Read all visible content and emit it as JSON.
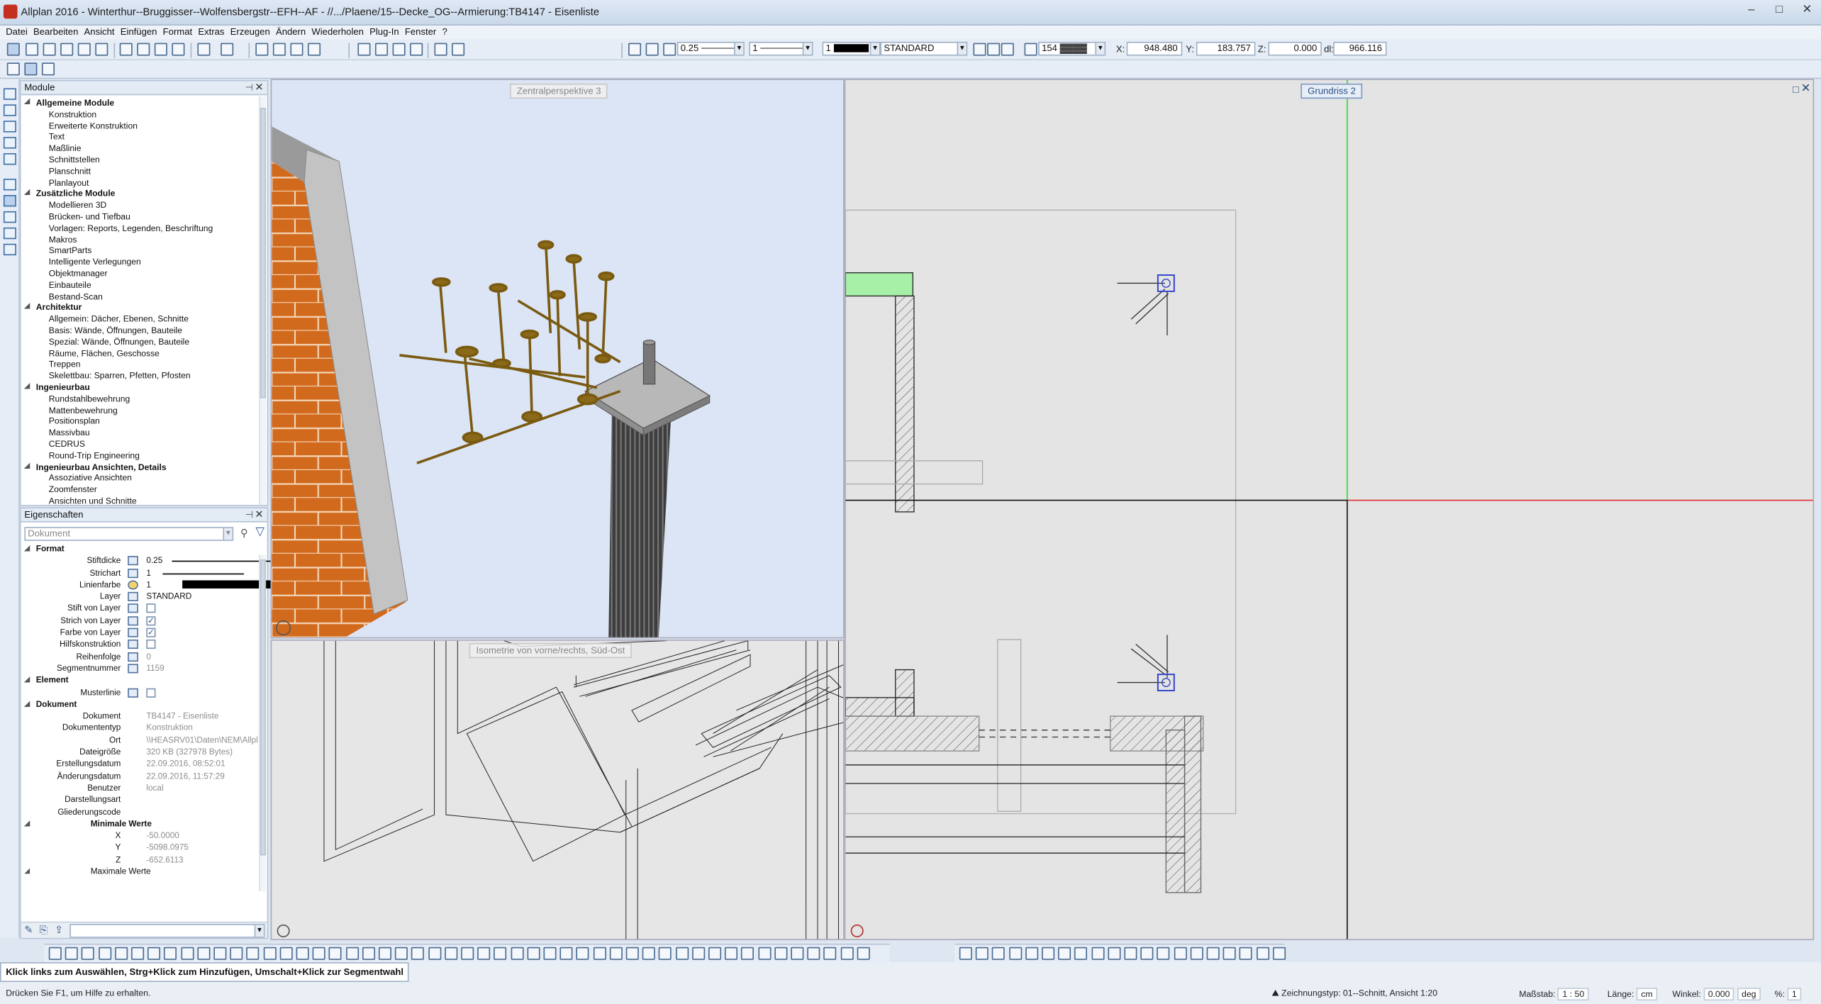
{
  "window": {
    "title": "Allplan 2016 - Winterthur--Bruggisser--Wolfensbergstr--EFH--AF - //.../Plaene/15--Decke_OG--Armierung:TB4147 - Eisenliste",
    "controls": [
      "–",
      "□",
      "✕"
    ]
  },
  "menu": [
    "Datei",
    "Bearbeiten",
    "Ansicht",
    "Einfügen",
    "Format",
    "Extras",
    "Erzeugen",
    "Ändern",
    "Wiederholen",
    "Plug-In",
    "Fenster",
    "?"
  ],
  "format_toolbar": {
    "pen": "0.25",
    "line": "1",
    "color": "1",
    "layer": "STANDARD",
    "pattern": "154"
  },
  "coords": {
    "x_label": "X:",
    "x": "948.480",
    "y_label": "Y:",
    "y": "183.757",
    "z_label": "Z:",
    "z": "0.000",
    "d_label": "dl:",
    "d": "966.116"
  },
  "modules_panel": {
    "title": "Module",
    "groups": [
      {
        "name": "Allgemeine Module",
        "items": [
          "Konstruktion",
          "Erweiterte Konstruktion",
          "Text",
          "Maßlinie",
          "Schnittstellen",
          "Planschnitt",
          "Planlayout"
        ]
      },
      {
        "name": "Zusätzliche Module",
        "items": [
          "Modellieren 3D",
          "Brücken- und Tiefbau",
          "Vorlagen: Reports, Legenden, Beschriftung",
          "Makros",
          "SmartParts",
          "Intelligente Verlegungen",
          "Objektmanager",
          "Einbauteile",
          "Bestand-Scan"
        ]
      },
      {
        "name": "Architektur",
        "items": [
          "Allgemein: Dächer, Ebenen, Schnitte",
          "Basis: Wände, Öffnungen, Bauteile",
          "Spezial: Wände, Öffnungen, Bauteile",
          "Räume, Flächen, Geschosse",
          "Treppen",
          "Skelettbau: Sparren, Pfetten, Pfosten"
        ]
      },
      {
        "name": "Ingenieurbau",
        "items": [
          "Rundstahlbewehrung",
          "Mattenbewehrung",
          "Positionsplan",
          "Massivbau",
          "CEDRUS",
          "Round-Trip Engineering"
        ]
      },
      {
        "name": "Ingenieurbau Ansichten, Details",
        "items": [
          "Assoziative Ansichten",
          "Zoomfenster",
          "Ansichten und Schnitte"
        ]
      }
    ]
  },
  "properties_panel": {
    "title": "Eigenschaften",
    "search_placeholder": "Dokument",
    "format_title": "Format",
    "format": {
      "stiftdicke_label": "Stiftdicke",
      "stiftdicke": "0.25",
      "strichart_label": "Strichart",
      "strichart": "1",
      "linienfarbe_label": "Linienfarbe",
      "linienfarbe": "1",
      "layer_label": "Layer",
      "layer": "STANDARD",
      "stift_von_layer_label": "Stift von Layer",
      "stift_von_layer": false,
      "strich_von_layer_label": "Strich von Layer",
      "strich_von_layer": true,
      "farbe_von_layer_label": "Farbe von Layer",
      "farbe_von_layer": true,
      "hilfskonstruktion_label": "Hilfskonstruktion",
      "hilfskonstruktion": false,
      "reihenfolge_label": "Reihenfolge",
      "reihenfolge": "0",
      "segmentnummer_label": "Segmentnummer",
      "segmentnummer": "1159"
    },
    "element_title": "Element",
    "element": {
      "musterlinie_label": "Musterlinie",
      "musterlinie": false
    },
    "dokument_title": "Dokument",
    "dokument": [
      {
        "label": "Dokument",
        "value": "TB4147 - Eisenliste"
      },
      {
        "label": "Dokumententyp",
        "value": "Konstruktion"
      },
      {
        "label": "Ort",
        "value": "\\\\HEASRV01\\Daten\\NEM\\Allpl"
      },
      {
        "label": "Dateigröße",
        "value": "320 KB (327978 Bytes)"
      },
      {
        "label": "Erstellungsdatum",
        "value": "22.09.2016, 08:52:01"
      },
      {
        "label": "Änderungsdatum",
        "value": "22.09.2016, 11:57:29"
      },
      {
        "label": "Benutzer",
        "value": "local"
      },
      {
        "label": "Darstellungsart",
        "value": ""
      },
      {
        "label": "Gliederungscode",
        "value": ""
      }
    ],
    "min_title": "Minimale Werte",
    "min": [
      {
        "label": "X",
        "value": "-50.0000"
      },
      {
        "label": "Y",
        "value": "-5098.0975"
      },
      {
        "label": "Z",
        "value": "-652.6113"
      }
    ],
    "max_title": "Maximale Werte"
  },
  "viewports": {
    "perspective_label": "Zentralperspektive 3",
    "isometric_label": "Isometrie von vorne/rechts, Süd-Ost",
    "plan_label": "Grundriss 2"
  },
  "status": {
    "hint": "Klick links zum Auswählen, Strg+Klick zum Hinzufügen, Umschalt+Klick zur Segmentwahl",
    "help": "Drücken Sie F1, um Hilfe zu erhalten.",
    "drawing_type_label": "Zeichnungstyp:",
    "drawing_type": "01--Schnitt, Ansicht 1:20",
    "scale_label": "Maßstab:",
    "scale": "1 : 50",
    "length_label": "Länge:",
    "length": "cm",
    "angle_label": "Winkel:",
    "angle": "0.000",
    "angle_unit": "deg",
    "percent_label": "%:",
    "percent": "1"
  },
  "colors": {
    "brick": "#d26a1d",
    "concrete": "#c8c8c8",
    "rebar": "#8a6a18",
    "persp_bg": "#dbe5f5",
    "plan_bg": "#e4e4e4",
    "selection": "#3344cc",
    "hatch_green": "#a7f0a7"
  }
}
